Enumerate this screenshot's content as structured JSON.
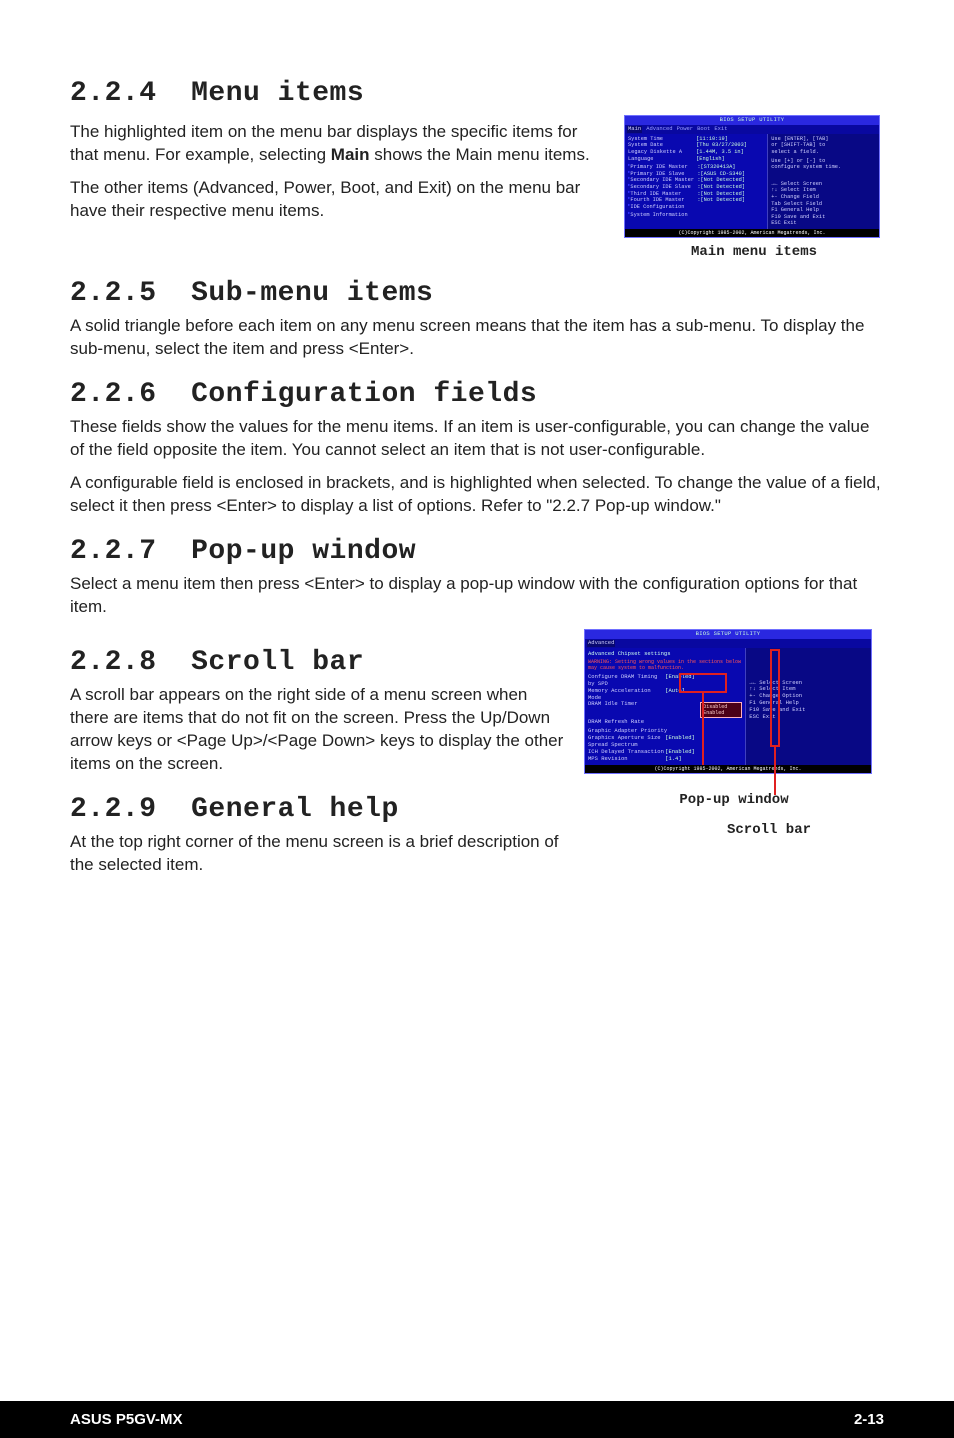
{
  "sections": {
    "s224": {
      "num": "2.2.4",
      "title": "Menu items"
    },
    "s225": {
      "num": "2.2.5",
      "title": "Sub-menu items"
    },
    "s226": {
      "num": "2.2.6",
      "title": "Configuration fields"
    },
    "s227": {
      "num": "2.2.7",
      "title": "Pop-up window"
    },
    "s228": {
      "num": "2.2.8",
      "title": "Scroll bar"
    },
    "s229": {
      "num": "2.2.9",
      "title": "General help"
    }
  },
  "para": {
    "p224a": "The highlighted item on the menu bar displays the specific items for that menu. For example, selecting ",
    "p224a_main": "Main",
    "p224a2": " shows the Main menu items.",
    "p224b": "The other items (Advanced, Power, Boot, and Exit) on the menu bar have their respective menu items.",
    "p225": "A solid triangle before each item on any menu screen means that the item has a sub-menu. To display the sub-menu, select the item and press <Enter>.",
    "p226a": "These fields show the values for the menu items. If an item is user-configurable, you can change the value of the field opposite the item. You cannot select an item that is not user-configurable.",
    "p226b": "A configurable field is enclosed in brackets, and is highlighted when selected. To change the value of a field, select it then press <Enter> to display a list of options. Refer to \"2.2.7 Pop-up window.\"",
    "p227": "Select a menu item then press <Enter> to display a pop-up window with the configuration options for that item.",
    "p228": "A scroll bar appears on the right side of a menu screen when there are items that do not fit on the screen. Press the Up/Down arrow keys or <Page Up>/<Page Down> keys to display the other items on the screen.",
    "p229": "At the top right corner of the menu screen is a brief description of the selected item."
  },
  "fig1": {
    "caption": "Main menu items",
    "titlebar": "BIOS SETUP UTILITY",
    "tabs": [
      "Main",
      "Advanced",
      "Power",
      "Boot",
      "Exit"
    ],
    "rows": [
      {
        "k": "System Time",
        "v": "[11:10:19]"
      },
      {
        "k": "System Date",
        "v": "[Thu 03/27/2003]"
      },
      {
        "k": "Legacy Diskette A",
        "v": "[1.44M, 3.5 in]"
      },
      {
        "k": "Language",
        "v": "[English]"
      }
    ],
    "subrows": [
      {
        "k": "Primary IDE Master",
        "v": ":[ST320413A]"
      },
      {
        "k": "Primary IDE Slave",
        "v": ":[ASUS CD-S340]"
      },
      {
        "k": "Secondary IDE Master",
        "v": ":[Not Detected]"
      },
      {
        "k": "Secondary IDE Slave",
        "v": ":[Not Detected]"
      },
      {
        "k": "Third IDE Master",
        "v": ":[Not Detected]"
      },
      {
        "k": "Fourth IDE Master",
        "v": ":[Not Detected]"
      },
      {
        "k": "IDE Configuration",
        "v": ""
      }
    ],
    "sysinfo": "System Information",
    "help_top": [
      "Use [ENTER], [TAB]",
      "or [SHIFT-TAB] to",
      "select a field.",
      "",
      "Use [+] or [-] to",
      "configure system time."
    ],
    "help_bot": [
      "→←  Select Screen",
      "↑↓  Select Item",
      "+-  Change Field",
      "Tab Select Field",
      "F1  General Help",
      "F10 Save and Exit",
      "ESC Exit"
    ],
    "footer": "(C)Copyright 1985-2002, American Megatrends, Inc."
  },
  "fig2": {
    "titlebar": "BIOS SETUP UTILITY",
    "tab": "Advanced",
    "hdr": "Advanced Chipset settings",
    "warn": "WARNING: Setting wrong values in the sections below may cause system to malfunction.",
    "rows": [
      {
        "k": "Configure DRAM Timing by SPD",
        "v": "[Enabled]"
      },
      {
        "k": "Memory Acceleration Mode",
        "v": "[Auto]"
      },
      {
        "k": "DRAM Idle Timer",
        "v": ""
      },
      {
        "k": "DRAM Refresh Rate",
        "v": ""
      }
    ],
    "popup": [
      "Disabled",
      "Enabled"
    ],
    "rows2": [
      {
        "k": "Graphic Adapter Priority",
        "v": ""
      },
      {
        "k": "Graphics Aperture Size",
        "v": "[Enabled]"
      },
      {
        "k": "Spread Spectrum",
        "v": ""
      },
      {
        "k": "ICH Delayed Transaction",
        "v": "[Enabled]"
      },
      {
        "k": "MPS Revision",
        "v": "[1.4]"
      }
    ],
    "help": [
      "→←  Select Screen",
      "↑↓  Select Item",
      "+-  Change Option",
      "F1  General Help",
      "F10 Save and Exit",
      "ESC Exit"
    ],
    "footer": "(C)Copyright 1985-2002, American Megatrends, Inc.",
    "caption_popup": "Pop-up window",
    "caption_scroll": "Scroll bar"
  },
  "footer": {
    "left": "ASUS P5GV-MX",
    "right": "2-13"
  }
}
